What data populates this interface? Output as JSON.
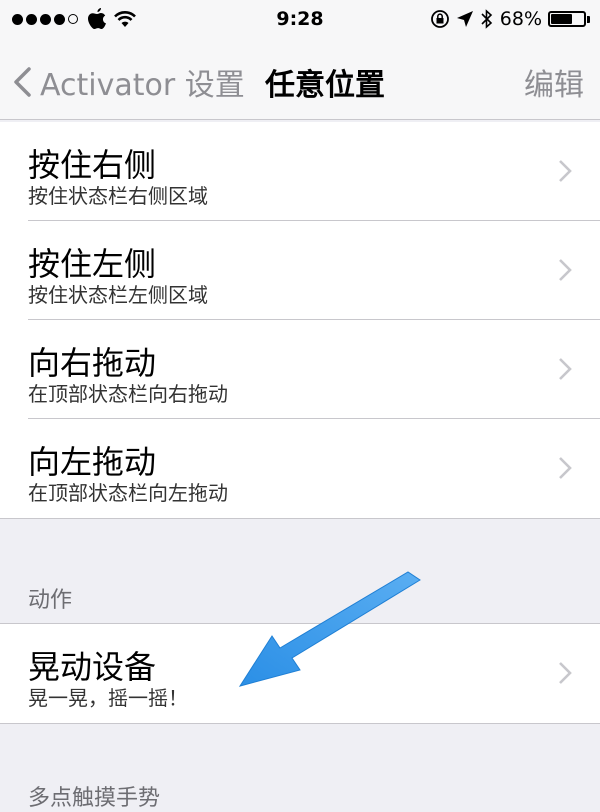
{
  "status_bar": {
    "time": "9:28",
    "battery_text": "68%",
    "battery_level": 0.68,
    "signal_bars_filled": 4,
    "signal_bars_total": 5,
    "icons": [
      "apple-icon",
      "wifi-icon",
      "rotation-lock-icon",
      "location-icon",
      "bluetooth-icon",
      "battery-icon"
    ]
  },
  "nav": {
    "back_label": "Activator 设置",
    "title": "任意位置",
    "edit_label": "编辑"
  },
  "rows": [
    {
      "title": "按住右侧",
      "subtitle": "按住状态栏右侧区域"
    },
    {
      "title": "按住左侧",
      "subtitle": "按住状态栏左侧区域"
    },
    {
      "title": "向右拖动",
      "subtitle": "在顶部状态栏向右拖动"
    },
    {
      "title": "向左拖动",
      "subtitle": "在顶部状态栏向左拖动"
    }
  ],
  "section_action": {
    "header": "动作",
    "rows": [
      {
        "title": "晃动设备",
        "subtitle": "晃一晃，摇一摇！"
      }
    ]
  },
  "section_next": {
    "header": "多点触摸手势"
  },
  "colors": {
    "background": "#efeff4",
    "bar": "#f7f7f8",
    "separator": "#c8c7cc",
    "accent_gray": "#8e8e93",
    "annotation_arrow": "#2b8fe6"
  }
}
